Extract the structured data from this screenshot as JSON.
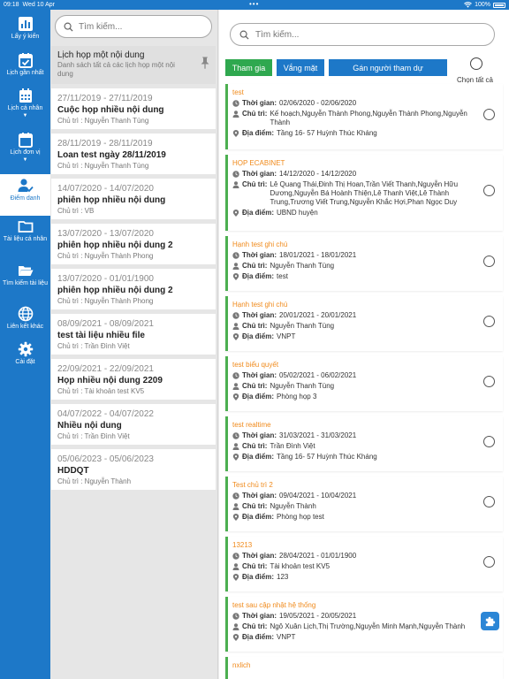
{
  "status_bar": {
    "time": "09:18",
    "date": "Wed 10 Apr",
    "battery": "100%"
  },
  "sidebar": {
    "items": [
      {
        "label": "Lấy ý kiến",
        "icon": "chart-icon"
      },
      {
        "label": "Lịch gần nhất",
        "icon": "calendar-check-icon"
      },
      {
        "label": "Lịch cá nhân",
        "icon": "calendar-grid-icon"
      },
      {
        "label": "Lịch đơn vị",
        "icon": "calendar-icon"
      },
      {
        "label": "Điểm danh",
        "icon": "user-check-icon"
      },
      {
        "label": "Tài liệu cá nhân",
        "icon": "folder-icon"
      },
      {
        "label": "Tìm kiếm tài liệu",
        "icon": "folder-open-icon"
      },
      {
        "label": "Liên kết khác",
        "icon": "globe-icon"
      },
      {
        "label": "Cài đặt",
        "icon": "gear-icon"
      }
    ]
  },
  "mid_panel": {
    "search_placeholder": "Tìm kiếm...",
    "header_item": {
      "title": "Lịch họp một nội dung",
      "description": "Danh sách tất cả các lịch họp một nội dung"
    },
    "meetings": [
      {
        "date": "27/11/2019 - 27/11/2019",
        "title": "Cuộc họp nhiều nội dung",
        "host": "Chủ trì : Nguyễn Thanh Tùng"
      },
      {
        "date": "28/11/2019 - 28/11/2019",
        "title": "Loan test ngày 28/11/2019",
        "host": "Chủ trì : Nguyễn Thanh Tùng"
      },
      {
        "date": "14/07/2020 - 14/07/2020",
        "title": "phiên họp nhiều nội dung",
        "host": "Chủ trì : VB"
      },
      {
        "date": "13/07/2020 - 13/07/2020",
        "title": "phiên họp nhiều nội dung 2",
        "host": "Chủ trì : Nguyễn Thành Phong"
      },
      {
        "date": "13/07/2020 - 01/01/1900",
        "title": "phiên họp nhiều nội dung 2",
        "host": "Chủ trì : Nguyễn Thành Phong"
      },
      {
        "date": "08/09/2021 - 08/09/2021",
        "title": "test tài liệu nhiều file",
        "host": "Chủ trì : Trần Đình Việt"
      },
      {
        "date": "22/09/2021 - 22/09/2021",
        "title": "Họp nhiều nội dung 2209",
        "host": "Chủ trì : Tài khoản test KV5"
      },
      {
        "date": "04/07/2022 - 04/07/2022",
        "title": "Nhiều nội dung",
        "host": "Chủ trì : Trần Đình Việt"
      },
      {
        "date": "05/06/2023 - 05/06/2023",
        "title": "HDDQT",
        "host": "Chủ trì : Nguyễn Thành"
      }
    ]
  },
  "main": {
    "search_placeholder": "Tìm kiếm...",
    "actions": {
      "attend": "Tham gia",
      "absent": "Vắng mặt",
      "assign": "Gán người tham dự",
      "select_all": "Chọn tất cả"
    },
    "labels": {
      "time": "Thời gian:",
      "host": "Chủ trì:",
      "place": "Địa điểm:"
    },
    "cards": [
      {
        "title": "test",
        "time": "02/06/2020 - 02/06/2020",
        "host": "Kế hoạch,Nguyễn Thành Phong,Nguyễn Thành Phong,Nguyễn Thành",
        "place": "Tầng 16- 57 Huỳnh Thúc Kháng"
      },
      {
        "title": "HỌP ECABINET",
        "time": "14/12/2020 - 14/12/2020",
        "host": "Lê Quang Thái,Đinh Thị Hoan,Trần Viết Thanh,Nguyễn Hữu Dương,Nguyễn Bá Hoành Thiện,Lê Thanh Việt,Lê Thành Trung,Trương Viết Trung,Nguyễn Khắc Hợi,Phan Ngọc Duy",
        "place": "UBND huyện"
      },
      {
        "title": "Hạnh test ghi chú",
        "time": "18/01/2021 - 18/01/2021",
        "host": "Nguyễn Thanh Tùng",
        "place": "test"
      },
      {
        "title": "Hạnh test ghi chú",
        "time": "20/01/2021 - 20/01/2021",
        "host": "Nguyễn Thanh Tùng",
        "place": "VNPT"
      },
      {
        "title": "test biểu quyết",
        "time": "05/02/2021 - 06/02/2021",
        "host": "Nguyễn Thanh Tùng",
        "place": "Phòng họp 3"
      },
      {
        "title": "test realtime",
        "time": "31/03/2021 - 31/03/2021",
        "host": "Trần Đình Việt",
        "place": "Tầng 16- 57 Huỳnh Thúc Kháng"
      },
      {
        "title": "Test chủ trì 2",
        "time": "09/04/2021 - 10/04/2021",
        "host": "Nguyễn Thành",
        "place": "Phòng họp test"
      },
      {
        "title": "13213",
        "time": "28/04/2021 - 01/01/1900",
        "host": "Tài khoản test KV5",
        "place": "123"
      },
      {
        "title": "test sau cập nhật hệ thống",
        "time": "19/05/2021 - 20/05/2021",
        "host": "Ngô Xuân Lịch,Thị Trường,Nguyễn Minh Mạnh,Nguyễn Thành",
        "place": "VNPT"
      },
      {
        "title": "nxlich",
        "time": "",
        "host": "",
        "place": ""
      }
    ]
  },
  "colors": {
    "primary": "#1d78c8",
    "attend": "#2fa84f",
    "card_title": "#f08a1b",
    "card_border": "#4caf50"
  }
}
